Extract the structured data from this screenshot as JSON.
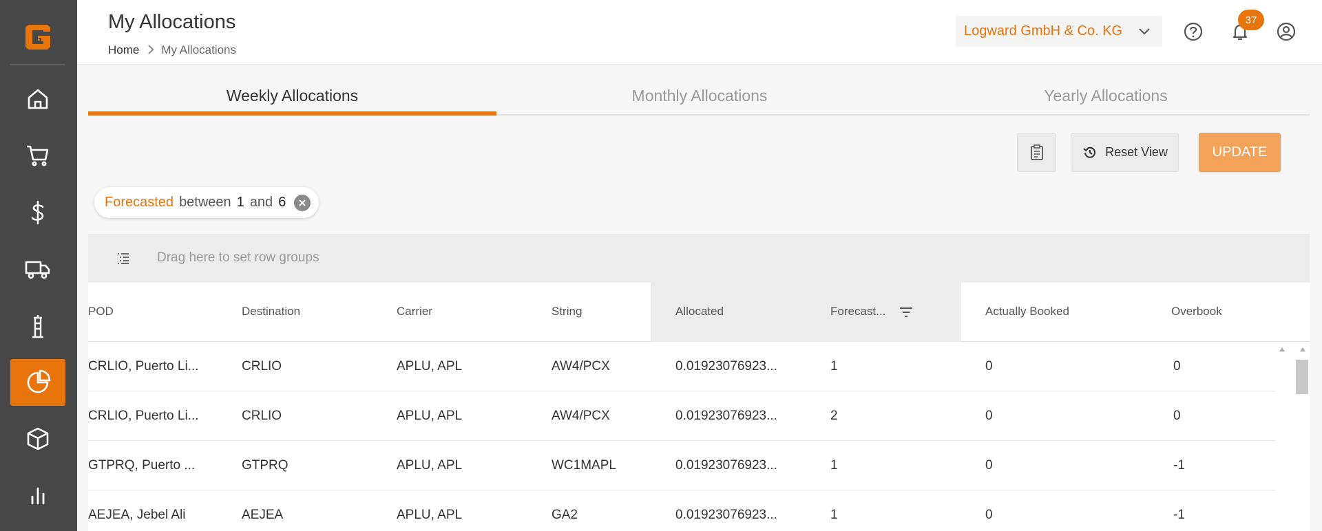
{
  "brand": {
    "accent": "#e8740c",
    "sidebar_bg": "#474747"
  },
  "sidebar": {
    "logo": "logo-icon",
    "items": [
      {
        "icon": "home-icon"
      },
      {
        "icon": "cart-icon"
      },
      {
        "icon": "dollar-icon"
      },
      {
        "icon": "truck-icon"
      },
      {
        "icon": "crane-icon"
      },
      {
        "icon": "pie-chart-icon",
        "active": true
      },
      {
        "icon": "box-icon"
      },
      {
        "icon": "bar-chart-icon"
      }
    ]
  },
  "header": {
    "title": "My Allocations",
    "breadcrumb": {
      "home": "Home",
      "current": "My Allocations"
    },
    "company": "Logward GmbH & Co. KG",
    "notifications_count": "37"
  },
  "tabs": [
    {
      "label": "Weekly Allocations",
      "active": true
    },
    {
      "label": "Monthly Allocations",
      "active": false
    },
    {
      "label": "Yearly Allocations",
      "active": false
    }
  ],
  "toolbar": {
    "reset_label": "Reset View",
    "update_label": "UPDATE"
  },
  "filter_chip": {
    "field": "Forecasted",
    "op": "between",
    "from": "1",
    "and": "and",
    "to": "6"
  },
  "rowgroup": {
    "placeholder": "Drag here to set row groups"
  },
  "grid": {
    "columns": [
      "POD",
      "Destination",
      "Carrier",
      "String",
      "Allocated",
      "Forecast...",
      "Actually Booked",
      "Overbook"
    ],
    "rows": [
      [
        "CRLIO, Puerto Li...",
        "CRLIO",
        "APLU, APL",
        "AW4/PCX",
        "0.01923076923...",
        "1",
        "0",
        "0"
      ],
      [
        "CRLIO, Puerto Li...",
        "CRLIO",
        "APLU, APL",
        "AW4/PCX",
        "0.01923076923...",
        "2",
        "0",
        "0"
      ],
      [
        "GTPRQ, Puerto ...",
        "GTPRQ",
        "APLU, APL",
        "WC1MAPL",
        "0.01923076923...",
        "1",
        "0",
        "-1"
      ],
      [
        "AEJEA, Jebel Ali",
        "AEJEA",
        "APLU, APL",
        "GA2",
        "0.01923076923...",
        "1",
        "0",
        "-1"
      ]
    ]
  }
}
